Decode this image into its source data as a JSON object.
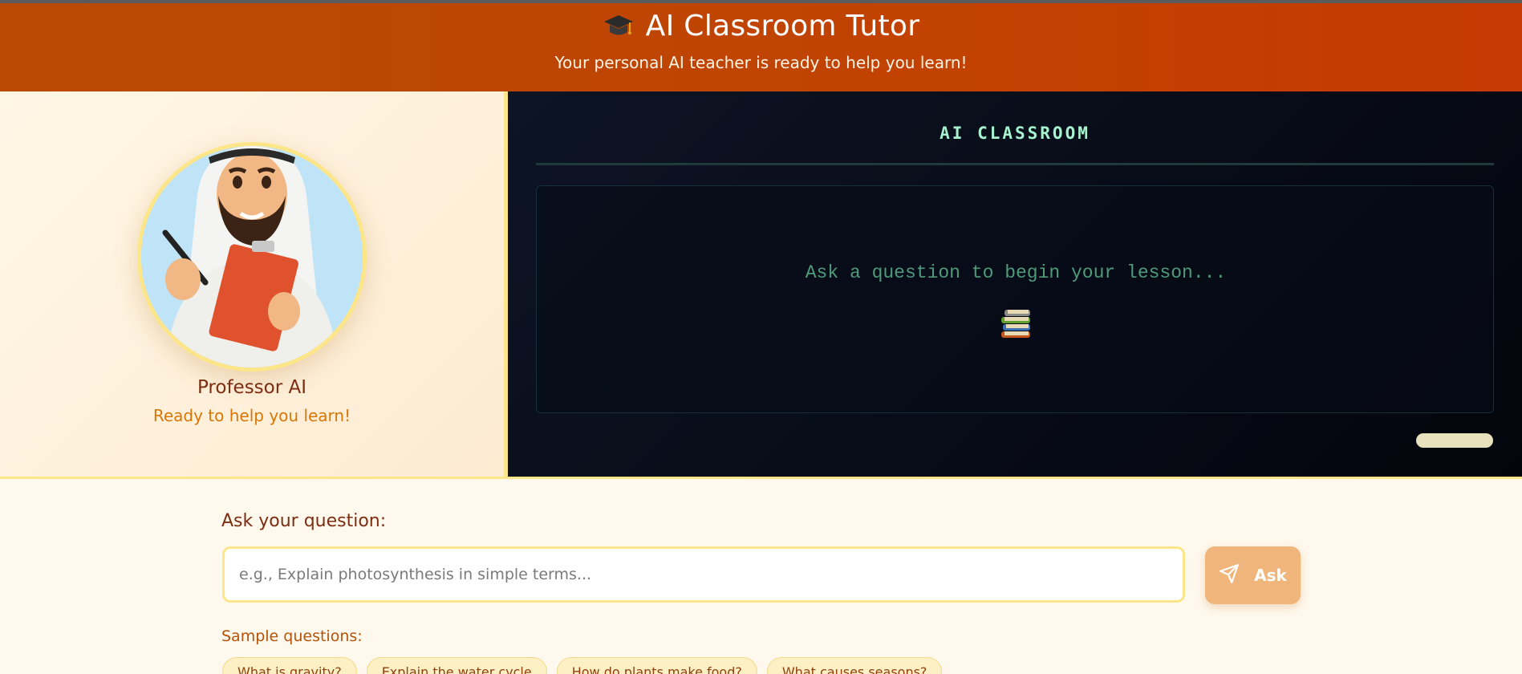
{
  "header": {
    "title": "AI Classroom Tutor",
    "subtitle": "Your personal AI teacher is ready to help you learn!",
    "icon": "graduation-cap-icon"
  },
  "tutor": {
    "name": "Professor AI",
    "status": "Ready to help you learn!"
  },
  "classroom": {
    "title": "AI CLASSROOM",
    "placeholder_message": "Ask a question to begin your lesson...",
    "icon": "books-icon"
  },
  "question": {
    "label": "Ask your question:",
    "placeholder": "e.g., Explain photosynthesis in simple terms...",
    "value": "",
    "ask_label": "Ask",
    "ask_icon": "send-icon"
  },
  "samples": {
    "label": "Sample questions:",
    "items": [
      "What is gravity?",
      "Explain the water cycle",
      "How do plants make food?",
      "What causes seasons?"
    ]
  },
  "colors": {
    "header": "#c04403",
    "accent": "#fde68a",
    "ask_button": "#f0b57a",
    "board_bg": "#070b16"
  }
}
